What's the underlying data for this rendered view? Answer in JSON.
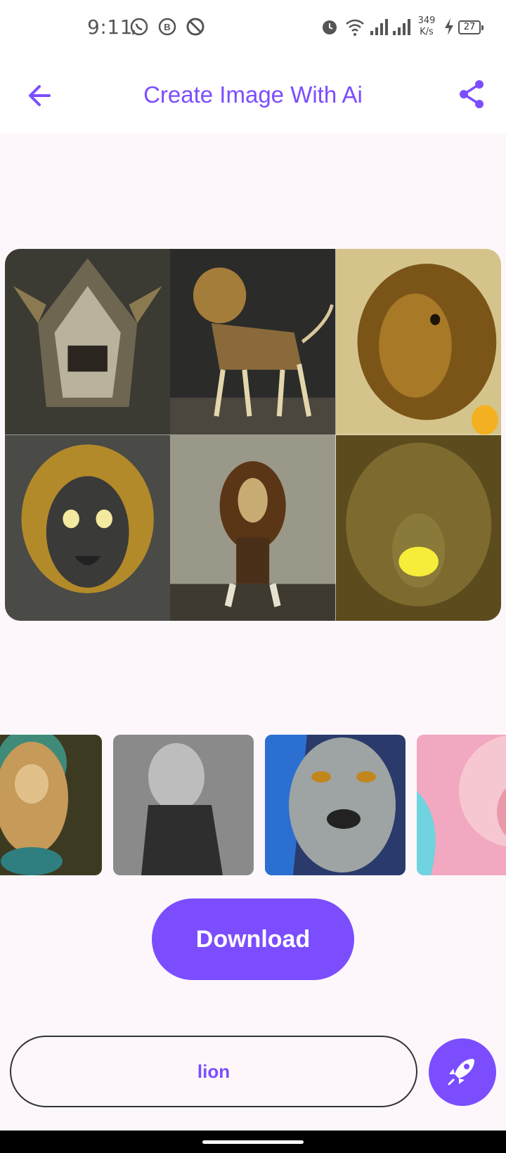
{
  "status_bar": {
    "time": "9:11",
    "speed": "349 K/s",
    "battery": "27",
    "icons": [
      "whatsapp-icon",
      "b-icon",
      "no-disturb-icon",
      "alarm-icon",
      "wifi-icon",
      "signal-icon",
      "signal-icon",
      "charging-icon"
    ]
  },
  "header": {
    "title": "Create Image With Ai",
    "back_icon": "arrow-left-icon",
    "share_icon": "share-icon"
  },
  "grid_images": [
    {
      "name": "lion-skull-image"
    },
    {
      "name": "lion-skeleton-image"
    },
    {
      "name": "golden-lion-painting-image"
    },
    {
      "name": "masked-lion-image"
    },
    {
      "name": "standing-lion-image"
    },
    {
      "name": "glowing-lion-image"
    }
  ],
  "thumbnails": [
    {
      "name": "ornate-lion-thumbnail"
    },
    {
      "name": "gray-lion-warrior-thumbnail"
    },
    {
      "name": "blue-lion-face-thumbnail"
    },
    {
      "name": "pink-lion-thumbnail"
    }
  ],
  "actions": {
    "download_label": "Download"
  },
  "prompt": {
    "value": "lion",
    "generate_icon": "rocket-icon"
  },
  "colors": {
    "accent": "#7c4dff",
    "background": "#fdf7fc"
  }
}
